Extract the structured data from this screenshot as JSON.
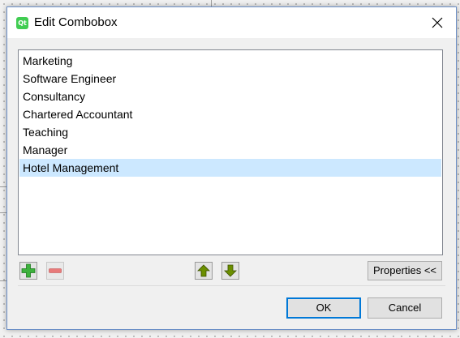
{
  "dialog": {
    "title": "Edit Combobox",
    "app_icon_text": "Qt"
  },
  "list": {
    "items": [
      "Marketing",
      "Software Engineer",
      "Consultancy",
      "Chartered Accountant",
      "Teaching",
      "Manager",
      "Hotel Management"
    ],
    "selected": "Hotel Management"
  },
  "toolbar": {
    "properties_label": "Properties <<",
    "add_icon": "plus-icon",
    "remove_icon": "minus-icon",
    "up_icon": "arrow-up-icon",
    "down_icon": "arrow-down-icon"
  },
  "buttons": {
    "ok_label": "OK",
    "cancel_label": "Cancel"
  },
  "colors": {
    "selection": "#cce8ff",
    "accent": "#0078d7",
    "add_green": "#3cb13c",
    "remove_red": "#e06a6a",
    "arrow_olive": "#5c7a00"
  }
}
